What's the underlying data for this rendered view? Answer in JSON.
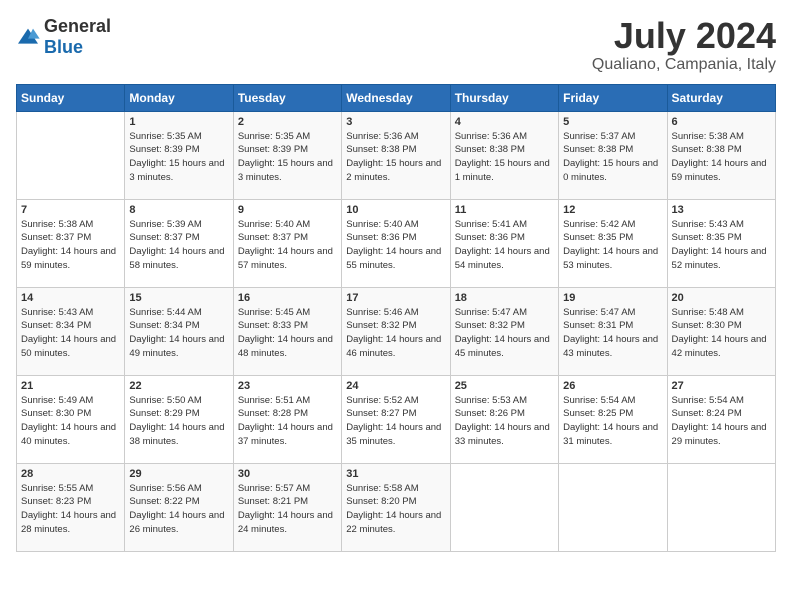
{
  "logo": {
    "general": "General",
    "blue": "Blue"
  },
  "header": {
    "month": "July 2024",
    "location": "Qualiano, Campania, Italy"
  },
  "days_of_week": [
    "Sunday",
    "Monday",
    "Tuesday",
    "Wednesday",
    "Thursday",
    "Friday",
    "Saturday"
  ],
  "weeks": [
    [
      {
        "day": "",
        "sunrise": "",
        "sunset": "",
        "daylight": ""
      },
      {
        "day": "1",
        "sunrise": "5:35 AM",
        "sunset": "8:39 PM",
        "daylight": "15 hours and 3 minutes."
      },
      {
        "day": "2",
        "sunrise": "5:35 AM",
        "sunset": "8:39 PM",
        "daylight": "15 hours and 3 minutes."
      },
      {
        "day": "3",
        "sunrise": "5:36 AM",
        "sunset": "8:38 PM",
        "daylight": "15 hours and 2 minutes."
      },
      {
        "day": "4",
        "sunrise": "5:36 AM",
        "sunset": "8:38 PM",
        "daylight": "15 hours and 1 minute."
      },
      {
        "day": "5",
        "sunrise": "5:37 AM",
        "sunset": "8:38 PM",
        "daylight": "15 hours and 0 minutes."
      },
      {
        "day": "6",
        "sunrise": "5:38 AM",
        "sunset": "8:38 PM",
        "daylight": "14 hours and 59 minutes."
      }
    ],
    [
      {
        "day": "7",
        "sunrise": "5:38 AM",
        "sunset": "8:37 PM",
        "daylight": "14 hours and 59 minutes."
      },
      {
        "day": "8",
        "sunrise": "5:39 AM",
        "sunset": "8:37 PM",
        "daylight": "14 hours and 58 minutes."
      },
      {
        "day": "9",
        "sunrise": "5:40 AM",
        "sunset": "8:37 PM",
        "daylight": "14 hours and 57 minutes."
      },
      {
        "day": "10",
        "sunrise": "5:40 AM",
        "sunset": "8:36 PM",
        "daylight": "14 hours and 55 minutes."
      },
      {
        "day": "11",
        "sunrise": "5:41 AM",
        "sunset": "8:36 PM",
        "daylight": "14 hours and 54 minutes."
      },
      {
        "day": "12",
        "sunrise": "5:42 AM",
        "sunset": "8:35 PM",
        "daylight": "14 hours and 53 minutes."
      },
      {
        "day": "13",
        "sunrise": "5:43 AM",
        "sunset": "8:35 PM",
        "daylight": "14 hours and 52 minutes."
      }
    ],
    [
      {
        "day": "14",
        "sunrise": "5:43 AM",
        "sunset": "8:34 PM",
        "daylight": "14 hours and 50 minutes."
      },
      {
        "day": "15",
        "sunrise": "5:44 AM",
        "sunset": "8:34 PM",
        "daylight": "14 hours and 49 minutes."
      },
      {
        "day": "16",
        "sunrise": "5:45 AM",
        "sunset": "8:33 PM",
        "daylight": "14 hours and 48 minutes."
      },
      {
        "day": "17",
        "sunrise": "5:46 AM",
        "sunset": "8:32 PM",
        "daylight": "14 hours and 46 minutes."
      },
      {
        "day": "18",
        "sunrise": "5:47 AM",
        "sunset": "8:32 PM",
        "daylight": "14 hours and 45 minutes."
      },
      {
        "day": "19",
        "sunrise": "5:47 AM",
        "sunset": "8:31 PM",
        "daylight": "14 hours and 43 minutes."
      },
      {
        "day": "20",
        "sunrise": "5:48 AM",
        "sunset": "8:30 PM",
        "daylight": "14 hours and 42 minutes."
      }
    ],
    [
      {
        "day": "21",
        "sunrise": "5:49 AM",
        "sunset": "8:30 PM",
        "daylight": "14 hours and 40 minutes."
      },
      {
        "day": "22",
        "sunrise": "5:50 AM",
        "sunset": "8:29 PM",
        "daylight": "14 hours and 38 minutes."
      },
      {
        "day": "23",
        "sunrise": "5:51 AM",
        "sunset": "8:28 PM",
        "daylight": "14 hours and 37 minutes."
      },
      {
        "day": "24",
        "sunrise": "5:52 AM",
        "sunset": "8:27 PM",
        "daylight": "14 hours and 35 minutes."
      },
      {
        "day": "25",
        "sunrise": "5:53 AM",
        "sunset": "8:26 PM",
        "daylight": "14 hours and 33 minutes."
      },
      {
        "day": "26",
        "sunrise": "5:54 AM",
        "sunset": "8:25 PM",
        "daylight": "14 hours and 31 minutes."
      },
      {
        "day": "27",
        "sunrise": "5:54 AM",
        "sunset": "8:24 PM",
        "daylight": "14 hours and 29 minutes."
      }
    ],
    [
      {
        "day": "28",
        "sunrise": "5:55 AM",
        "sunset": "8:23 PM",
        "daylight": "14 hours and 28 minutes."
      },
      {
        "day": "29",
        "sunrise": "5:56 AM",
        "sunset": "8:22 PM",
        "daylight": "14 hours and 26 minutes."
      },
      {
        "day": "30",
        "sunrise": "5:57 AM",
        "sunset": "8:21 PM",
        "daylight": "14 hours and 24 minutes."
      },
      {
        "day": "31",
        "sunrise": "5:58 AM",
        "sunset": "8:20 PM",
        "daylight": "14 hours and 22 minutes."
      },
      {
        "day": "",
        "sunrise": "",
        "sunset": "",
        "daylight": ""
      },
      {
        "day": "",
        "sunrise": "",
        "sunset": "",
        "daylight": ""
      },
      {
        "day": "",
        "sunrise": "",
        "sunset": "",
        "daylight": ""
      }
    ]
  ]
}
